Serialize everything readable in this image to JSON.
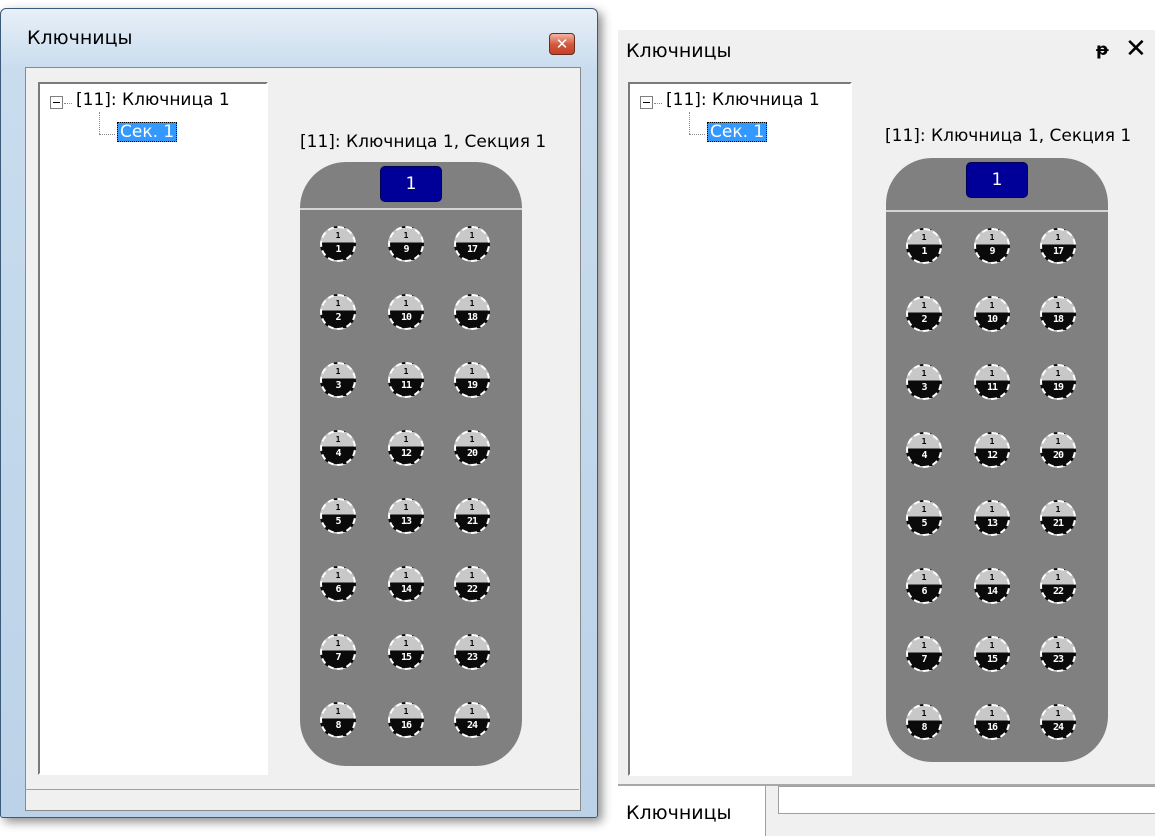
{
  "floating_window": {
    "title": "Ключницы",
    "close_glyph": "✕",
    "tree": {
      "root_label": "[11]: Ключница 1",
      "child_label": "Сек. 1"
    },
    "caption": "[11]: Ключница 1, Секция 1",
    "section_badge": "1"
  },
  "docked_panel": {
    "title": "Ключницы",
    "pin_glyph": "ᵽ",
    "close_glyph": "✕",
    "tree": {
      "root_label": "[11]: Ключница 1",
      "child_label": "Сек. 1"
    },
    "caption": "[11]: Ключница 1, Секция 1",
    "section_badge": "1",
    "bottom_tab_label": "Ключницы"
  },
  "key_slots": {
    "top_label": "1",
    "columns": [
      [
        "1",
        "2",
        "3",
        "4",
        "5",
        "6",
        "7",
        "8"
      ],
      [
        "9",
        "10",
        "11",
        "12",
        "13",
        "14",
        "15",
        "16"
      ],
      [
        "17",
        "18",
        "19",
        "20",
        "21",
        "22",
        "23",
        "24"
      ]
    ]
  },
  "colors": {
    "selection": "#3399ff",
    "badge": "#000099",
    "cabinet": "#808080",
    "close_button": "#d2553a"
  }
}
